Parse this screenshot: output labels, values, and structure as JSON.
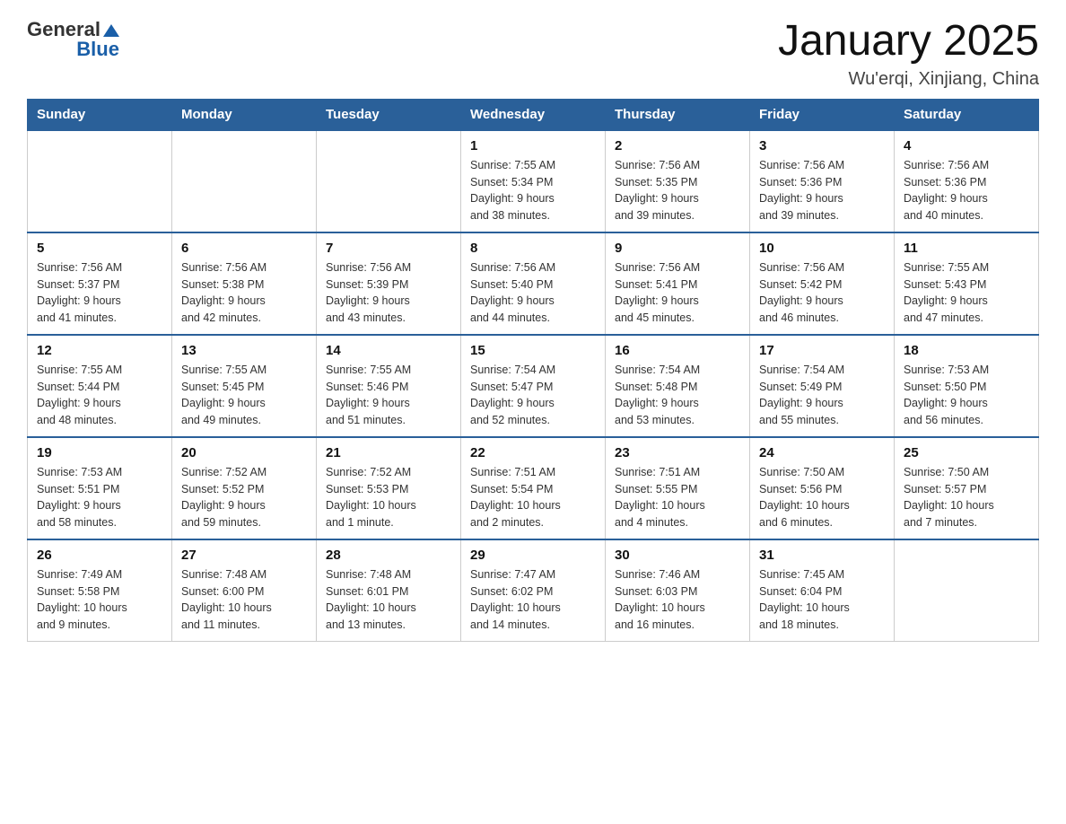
{
  "header": {
    "logo_general": "General",
    "logo_blue": "Blue",
    "title": "January 2025",
    "subtitle": "Wu'erqi, Xinjiang, China"
  },
  "days_of_week": [
    "Sunday",
    "Monday",
    "Tuesday",
    "Wednesday",
    "Thursday",
    "Friday",
    "Saturday"
  ],
  "weeks": [
    [
      {
        "day": "",
        "info": ""
      },
      {
        "day": "",
        "info": ""
      },
      {
        "day": "",
        "info": ""
      },
      {
        "day": "1",
        "info": "Sunrise: 7:55 AM\nSunset: 5:34 PM\nDaylight: 9 hours\nand 38 minutes."
      },
      {
        "day": "2",
        "info": "Sunrise: 7:56 AM\nSunset: 5:35 PM\nDaylight: 9 hours\nand 39 minutes."
      },
      {
        "day": "3",
        "info": "Sunrise: 7:56 AM\nSunset: 5:36 PM\nDaylight: 9 hours\nand 39 minutes."
      },
      {
        "day": "4",
        "info": "Sunrise: 7:56 AM\nSunset: 5:36 PM\nDaylight: 9 hours\nand 40 minutes."
      }
    ],
    [
      {
        "day": "5",
        "info": "Sunrise: 7:56 AM\nSunset: 5:37 PM\nDaylight: 9 hours\nand 41 minutes."
      },
      {
        "day": "6",
        "info": "Sunrise: 7:56 AM\nSunset: 5:38 PM\nDaylight: 9 hours\nand 42 minutes."
      },
      {
        "day": "7",
        "info": "Sunrise: 7:56 AM\nSunset: 5:39 PM\nDaylight: 9 hours\nand 43 minutes."
      },
      {
        "day": "8",
        "info": "Sunrise: 7:56 AM\nSunset: 5:40 PM\nDaylight: 9 hours\nand 44 minutes."
      },
      {
        "day": "9",
        "info": "Sunrise: 7:56 AM\nSunset: 5:41 PM\nDaylight: 9 hours\nand 45 minutes."
      },
      {
        "day": "10",
        "info": "Sunrise: 7:56 AM\nSunset: 5:42 PM\nDaylight: 9 hours\nand 46 minutes."
      },
      {
        "day": "11",
        "info": "Sunrise: 7:55 AM\nSunset: 5:43 PM\nDaylight: 9 hours\nand 47 minutes."
      }
    ],
    [
      {
        "day": "12",
        "info": "Sunrise: 7:55 AM\nSunset: 5:44 PM\nDaylight: 9 hours\nand 48 minutes."
      },
      {
        "day": "13",
        "info": "Sunrise: 7:55 AM\nSunset: 5:45 PM\nDaylight: 9 hours\nand 49 minutes."
      },
      {
        "day": "14",
        "info": "Sunrise: 7:55 AM\nSunset: 5:46 PM\nDaylight: 9 hours\nand 51 minutes."
      },
      {
        "day": "15",
        "info": "Sunrise: 7:54 AM\nSunset: 5:47 PM\nDaylight: 9 hours\nand 52 minutes."
      },
      {
        "day": "16",
        "info": "Sunrise: 7:54 AM\nSunset: 5:48 PM\nDaylight: 9 hours\nand 53 minutes."
      },
      {
        "day": "17",
        "info": "Sunrise: 7:54 AM\nSunset: 5:49 PM\nDaylight: 9 hours\nand 55 minutes."
      },
      {
        "day": "18",
        "info": "Sunrise: 7:53 AM\nSunset: 5:50 PM\nDaylight: 9 hours\nand 56 minutes."
      }
    ],
    [
      {
        "day": "19",
        "info": "Sunrise: 7:53 AM\nSunset: 5:51 PM\nDaylight: 9 hours\nand 58 minutes."
      },
      {
        "day": "20",
        "info": "Sunrise: 7:52 AM\nSunset: 5:52 PM\nDaylight: 9 hours\nand 59 minutes."
      },
      {
        "day": "21",
        "info": "Sunrise: 7:52 AM\nSunset: 5:53 PM\nDaylight: 10 hours\nand 1 minute."
      },
      {
        "day": "22",
        "info": "Sunrise: 7:51 AM\nSunset: 5:54 PM\nDaylight: 10 hours\nand 2 minutes."
      },
      {
        "day": "23",
        "info": "Sunrise: 7:51 AM\nSunset: 5:55 PM\nDaylight: 10 hours\nand 4 minutes."
      },
      {
        "day": "24",
        "info": "Sunrise: 7:50 AM\nSunset: 5:56 PM\nDaylight: 10 hours\nand 6 minutes."
      },
      {
        "day": "25",
        "info": "Sunrise: 7:50 AM\nSunset: 5:57 PM\nDaylight: 10 hours\nand 7 minutes."
      }
    ],
    [
      {
        "day": "26",
        "info": "Sunrise: 7:49 AM\nSunset: 5:58 PM\nDaylight: 10 hours\nand 9 minutes."
      },
      {
        "day": "27",
        "info": "Sunrise: 7:48 AM\nSunset: 6:00 PM\nDaylight: 10 hours\nand 11 minutes."
      },
      {
        "day": "28",
        "info": "Sunrise: 7:48 AM\nSunset: 6:01 PM\nDaylight: 10 hours\nand 13 minutes."
      },
      {
        "day": "29",
        "info": "Sunrise: 7:47 AM\nSunset: 6:02 PM\nDaylight: 10 hours\nand 14 minutes."
      },
      {
        "day": "30",
        "info": "Sunrise: 7:46 AM\nSunset: 6:03 PM\nDaylight: 10 hours\nand 16 minutes."
      },
      {
        "day": "31",
        "info": "Sunrise: 7:45 AM\nSunset: 6:04 PM\nDaylight: 10 hours\nand 18 minutes."
      },
      {
        "day": "",
        "info": ""
      }
    ]
  ]
}
